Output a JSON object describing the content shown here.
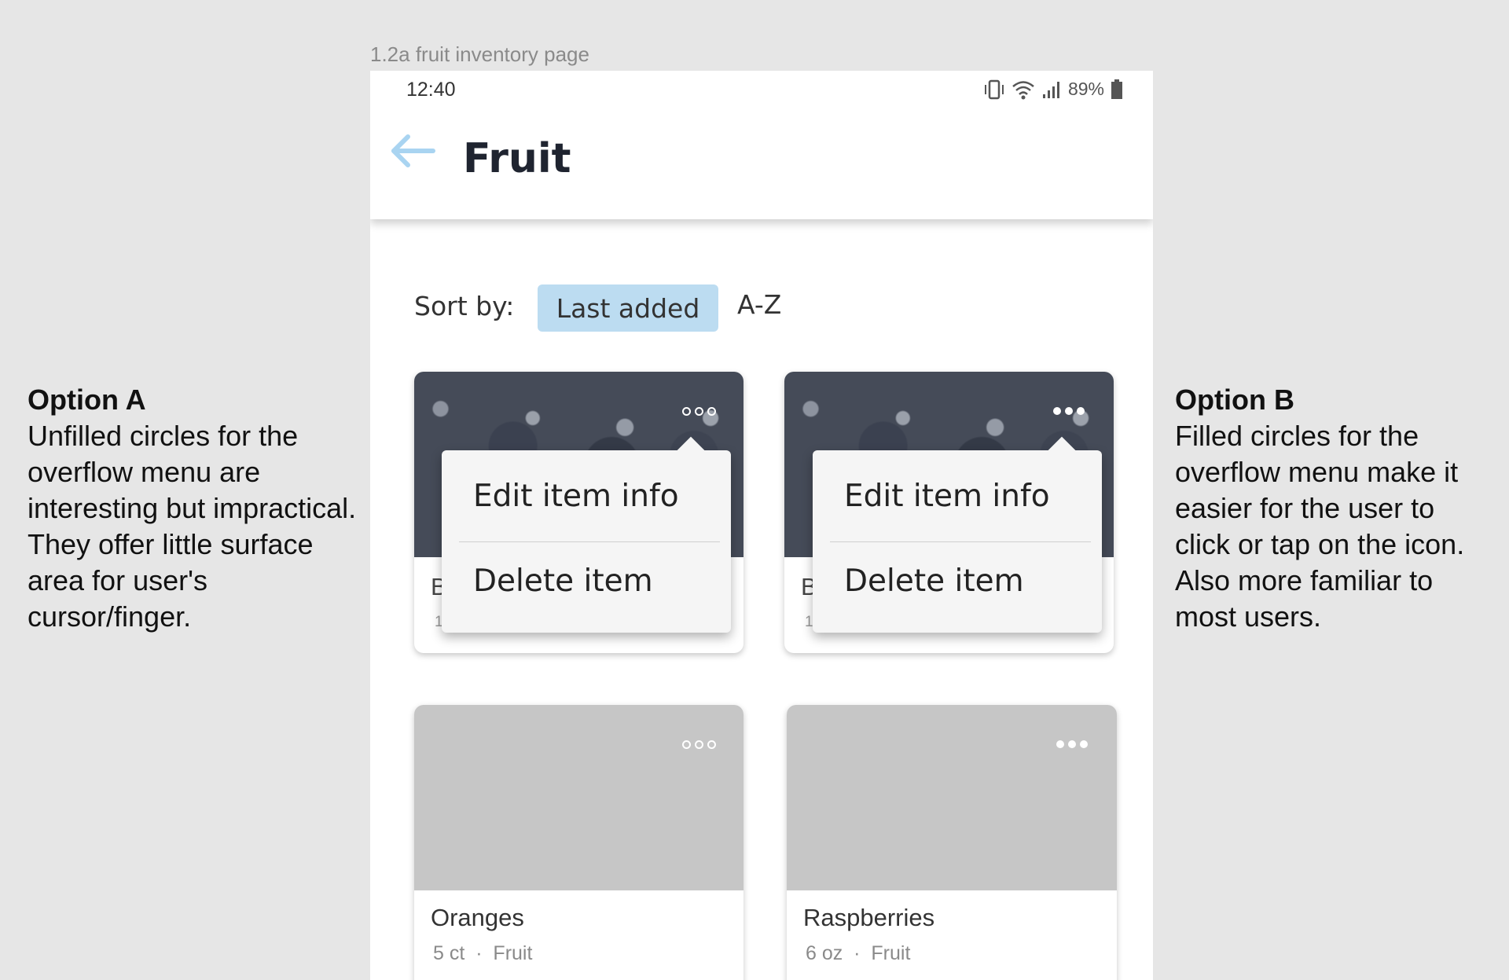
{
  "frame_label": "1.2a fruit inventory page",
  "status": {
    "time": "12:40",
    "battery": "89%"
  },
  "header": {
    "title": "Fruit"
  },
  "sort": {
    "label": "Sort by:",
    "options": [
      "Last added",
      "A-Z"
    ],
    "selected": "Last added"
  },
  "cards": [
    {
      "name": "B",
      "meta": "1",
      "menu": [
        "Edit item info",
        "Delete item"
      ],
      "dots_style": "unfilled"
    },
    {
      "name": "B",
      "meta": "1",
      "menu": [
        "Edit item info",
        "Delete item"
      ],
      "dots_style": "filled"
    },
    {
      "name": "Oranges",
      "qty": "5 ct",
      "category": "Fruit",
      "dots_style": "unfilled"
    },
    {
      "name": "Raspberries",
      "qty": "6 oz",
      "category": "Fruit",
      "dots_style": "filled"
    }
  ],
  "annotations": {
    "option_a": {
      "title": "Option A",
      "body": "Unfilled circles for the overflow menu are interesting but impractical. They offer little surface area for user's cursor/finger."
    },
    "option_b": {
      "title": "Option B",
      "body": "Filled circles for the overflow menu make it easier for the user to click or tap on the icon. Also more familiar to most users."
    }
  },
  "icons": {
    "back": "arrow-left-icon",
    "overflow": "more-horizontal-icon"
  },
  "colors": {
    "accent": "#bcdcf1",
    "back_arrow": "#a9d4f1"
  }
}
